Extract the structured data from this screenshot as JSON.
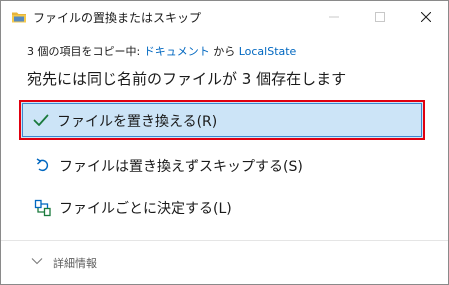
{
  "window": {
    "title": "ファイルの置換またはスキップ"
  },
  "copy_info": {
    "prefix": "3 個の項目をコピー中: ",
    "source": "ドキュメント",
    "middle": " から ",
    "destination": "LocalState"
  },
  "heading": "宛先には同じ名前のファイルが 3 個存在します",
  "options": [
    {
      "label": "ファイルを置き換える(R)",
      "icon": "check-icon",
      "selected": true
    },
    {
      "label": "ファイルは置き換えずスキップする(S)",
      "icon": "skip-arrow-icon"
    },
    {
      "label": "ファイルごとに決定する(L)",
      "icon": "compare-files-icon"
    }
  ],
  "details": {
    "label": "詳細情報"
  },
  "colors": {
    "accent": "#0067c0",
    "selected_bg": "#cce4f7",
    "highlight_border": "#e0000f",
    "check": "#1a7a3c"
  }
}
